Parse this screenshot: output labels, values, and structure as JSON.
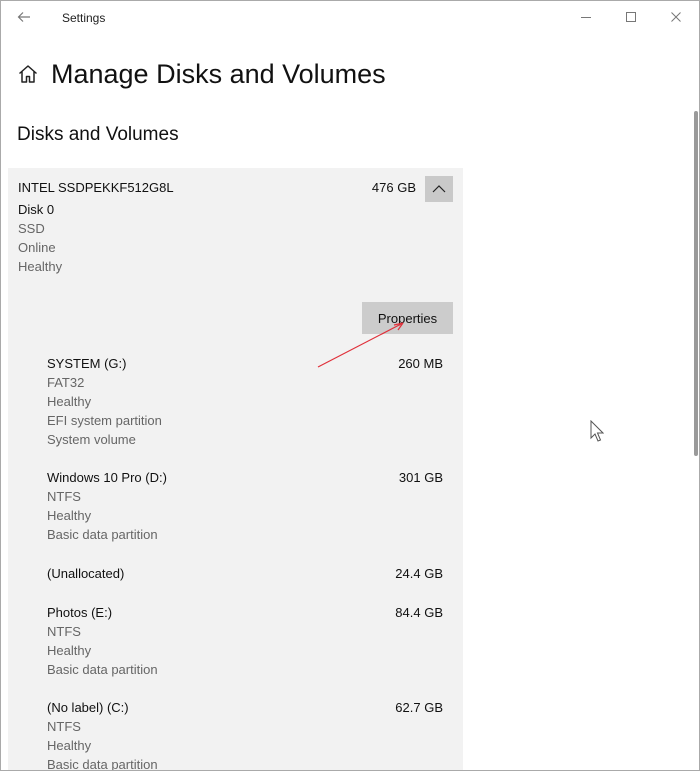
{
  "window": {
    "app_title": "Settings",
    "controls": {
      "back": "back-arrow-icon",
      "minimize": "minimize-icon",
      "maximize": "maximize-icon",
      "close": "close-icon"
    }
  },
  "page": {
    "title": "Manage Disks and Volumes",
    "section_title": "Disks and Volumes"
  },
  "disk": {
    "name": "INTEL SSDPEKKF512G8L",
    "size": "476 GB",
    "number": "Disk 0",
    "type": "SSD",
    "status": "Online",
    "health": "Healthy",
    "properties_label": "Properties"
  },
  "volumes": [
    {
      "name": "SYSTEM (G:)",
      "size": "260 MB",
      "details": [
        "FAT32",
        "Healthy",
        "EFI system partition",
        "System volume"
      ]
    },
    {
      "name": "Windows 10 Pro (D:)",
      "size": "301 GB",
      "details": [
        "NTFS",
        "Healthy",
        "Basic data partition"
      ]
    },
    {
      "name": "(Unallocated)",
      "size": "24.4 GB",
      "details": []
    },
    {
      "name": "Photos (E:)",
      "size": "84.4 GB",
      "details": [
        "NTFS",
        "Healthy",
        "Basic data partition"
      ]
    },
    {
      "name": "(No label) (C:)",
      "size": "62.7 GB",
      "details": [
        "NTFS",
        "Healthy",
        "Basic data partition"
      ]
    }
  ],
  "colors": {
    "panel": "#f2f2f2",
    "button": "#cccccc",
    "annotation_arrow": "#e0303a"
  }
}
